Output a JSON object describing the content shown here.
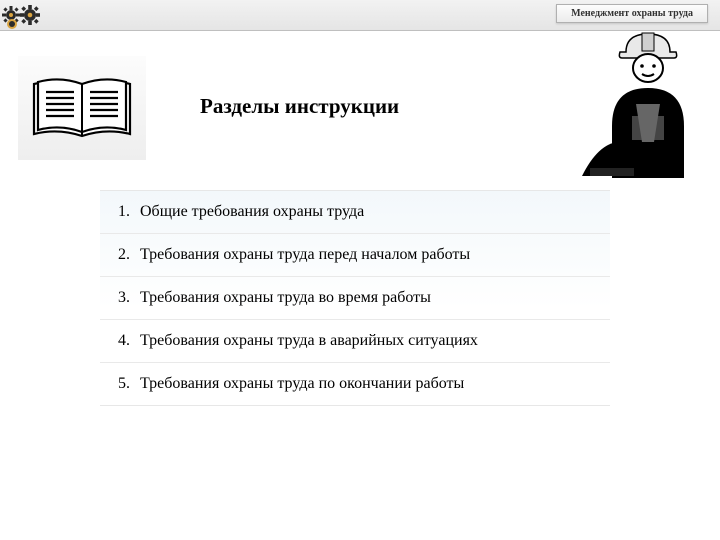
{
  "badge": "Менеджмент охраны труда",
  "heading": "Разделы  инструкции",
  "items": [
    {
      "num": "1.",
      "text": "Общие требования охраны труда"
    },
    {
      "num": "2.",
      "text": "Требования охраны труда перед началом работы"
    },
    {
      "num": "3.",
      "text": "Требования охраны труда во время работы"
    },
    {
      "num": "4.",
      "text": "Требования охраны труда в аварийных ситуациях"
    },
    {
      "num": "5.",
      "text": "Требования охраны труда по окончании работы"
    }
  ]
}
